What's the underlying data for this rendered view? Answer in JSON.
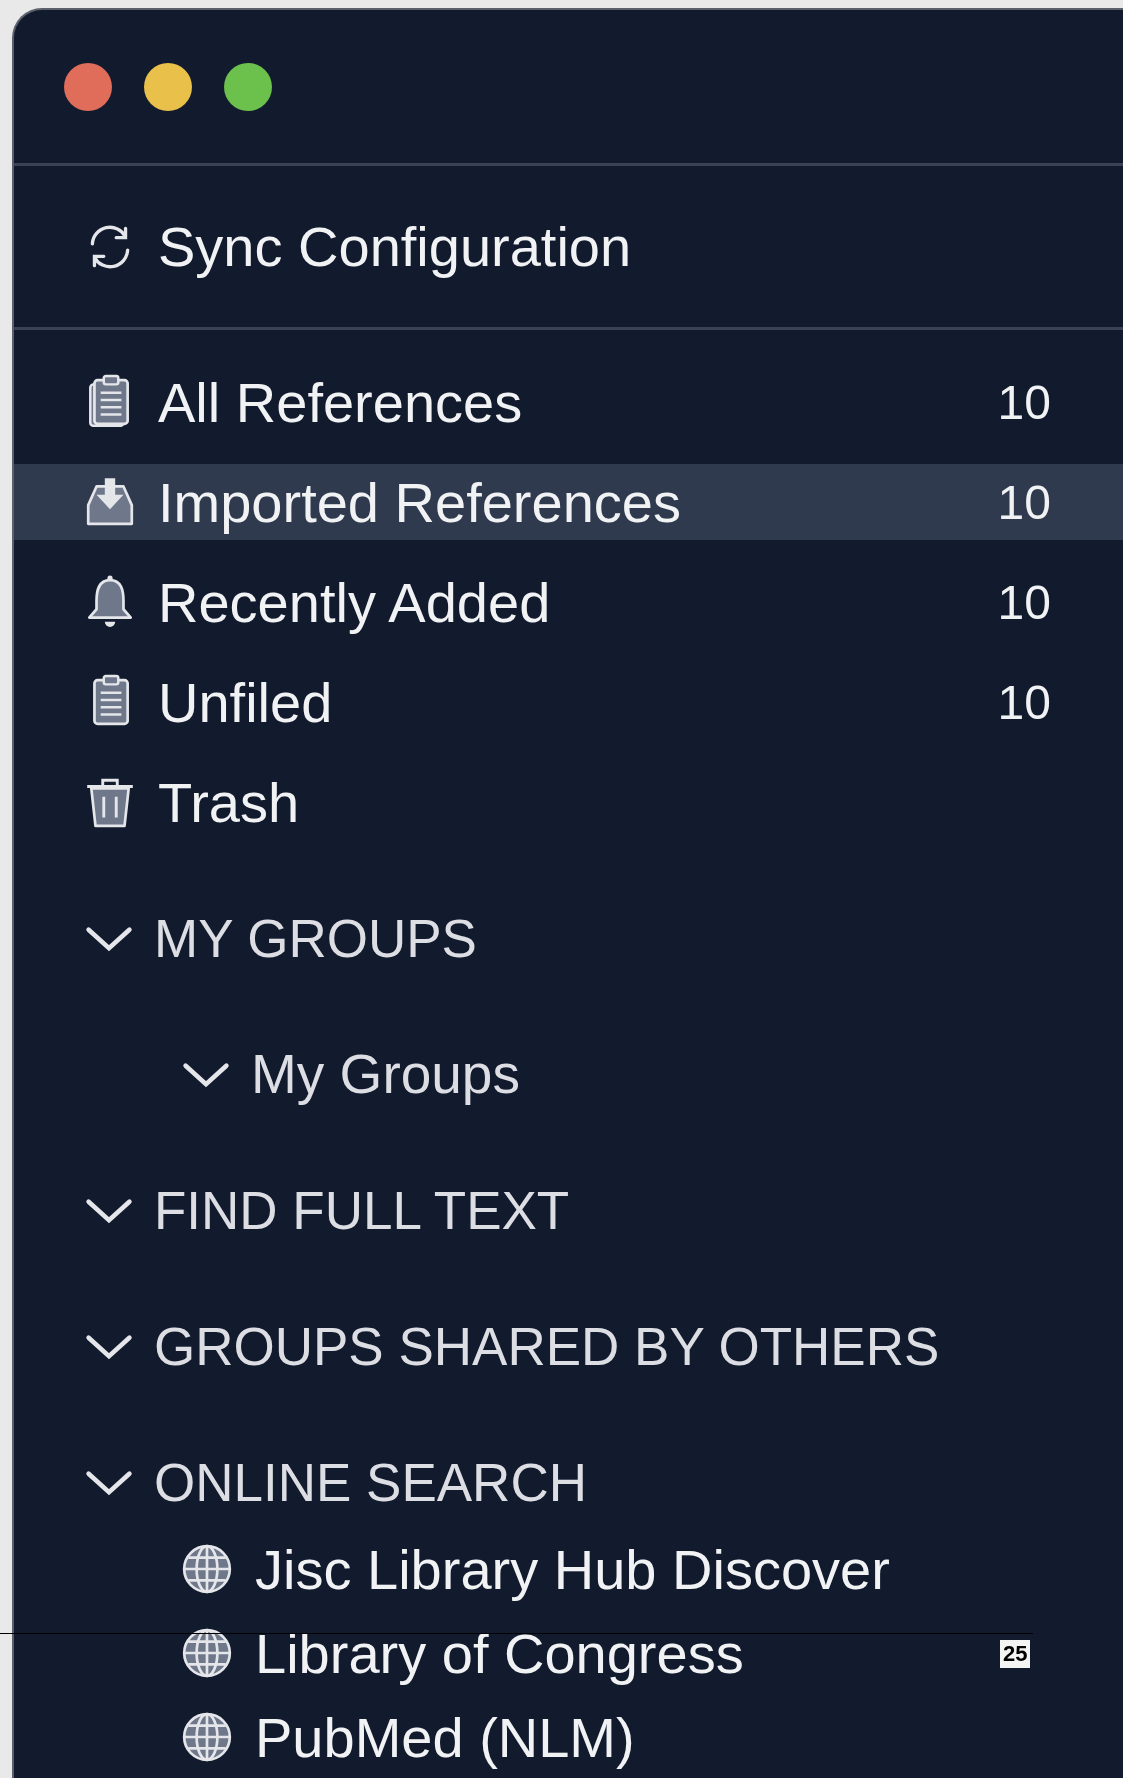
{
  "window": {
    "controls": [
      {
        "color": "#e06c5a"
      },
      {
        "color": "#e8c04a"
      },
      {
        "color": "#6cc04c"
      }
    ]
  },
  "sync": {
    "label": "Sync Configuration"
  },
  "library": [
    {
      "label": "All References",
      "count": "10",
      "selected": false
    },
    {
      "label": "Imported References",
      "count": "10",
      "selected": true
    },
    {
      "label": "Recently Added",
      "count": "10",
      "selected": false
    },
    {
      "label": "Unfiled",
      "count": "10",
      "selected": false
    },
    {
      "label": "Trash",
      "selected": false
    }
  ],
  "sections": [
    {
      "title": "MY GROUPS",
      "expanded": true,
      "children": [
        {
          "kind": "group",
          "label": "My Groups",
          "expanded": true
        }
      ]
    },
    {
      "title": "FIND FULL TEXT",
      "expanded": true
    },
    {
      "title": "GROUPS SHARED BY OTHERS",
      "expanded": true
    },
    {
      "title": "ONLINE SEARCH",
      "expanded": true,
      "children": [
        {
          "kind": "site",
          "label": "Jisc Library Hub Discover"
        },
        {
          "kind": "site",
          "label": "Library of Congress"
        },
        {
          "kind": "site",
          "label": "PubMed (NLM)"
        }
      ]
    }
  ],
  "page_number": "25"
}
